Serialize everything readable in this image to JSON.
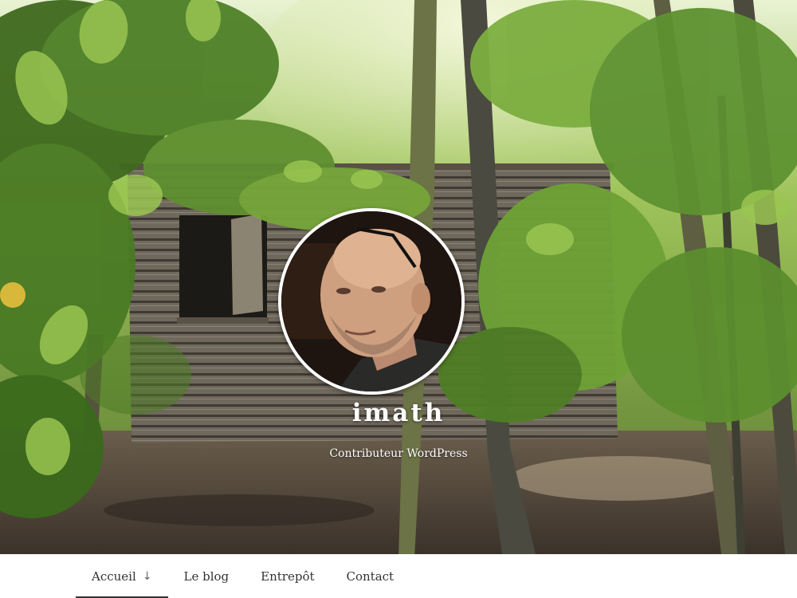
{
  "site": {
    "title": "imath",
    "description": "Contributeur WordPress"
  },
  "header_image": {
    "alt": "Forest cabin header photo",
    "palette": {
      "foliage": "#5e8a2c",
      "light_foliage": "#b6d86a",
      "cabin_wood": "#6b6458",
      "ground": "#4a4036",
      "trunk": "#4b4a40"
    }
  },
  "avatar": {
    "alt": "imath avatar",
    "border_color": "#ffffff"
  },
  "nav": {
    "items": [
      {
        "label": "Accueil",
        "current": true,
        "icon": "arrow-down-icon",
        "icon_glyph": "↓"
      },
      {
        "label": "Le blog",
        "current": false
      },
      {
        "label": "Entrepôt",
        "current": false
      },
      {
        "label": "Contact",
        "current": false
      }
    ]
  }
}
